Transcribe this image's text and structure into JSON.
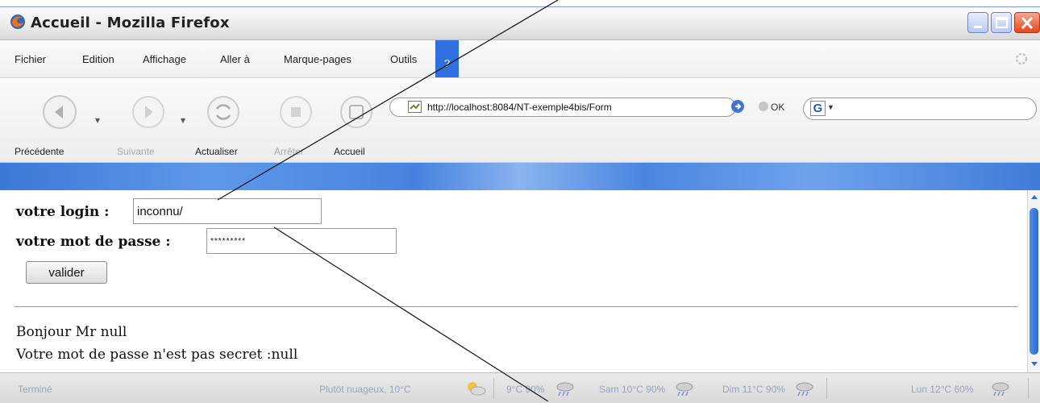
{
  "window": {
    "title": "Accueil - Mozilla Firefox"
  },
  "menu": {
    "items": [
      "Fichier",
      "Edition",
      "Affichage",
      "Aller à",
      "Marque-pages",
      "Outils"
    ],
    "help": "?"
  },
  "navigation": {
    "back": "Précédente",
    "forward": "Suivante",
    "reload": "Actualiser",
    "stop": "Arrêter",
    "home": "Accueil"
  },
  "address": {
    "url": "http://localhost:8084/NT-exemple4bis/Form"
  },
  "go": {
    "label": "OK"
  },
  "search": {
    "engine_icon": "G"
  },
  "form": {
    "login_label": "votre login :",
    "login_value": "inconnu/",
    "password_label": "votre mot de passe :",
    "password_value": "*********",
    "submit_label": "valider"
  },
  "response": {
    "line1": "Bonjour Mr null",
    "line2": "Votre mot de passe n'est pas secret :null"
  },
  "status": {
    "text": "Terminé",
    "weather_now": "Plutôt nuageux, 10°C",
    "forecast1": "9°C 90%",
    "forecast2": "Sam 10°C 90%",
    "forecast3": "Dim 11°C 90%",
    "forecast4": "Lun 12°C 60%"
  },
  "colors": {
    "accent": "#2f6fe0",
    "content_bg": "#ffffff",
    "toolbar_strip": "#3b78d8"
  }
}
